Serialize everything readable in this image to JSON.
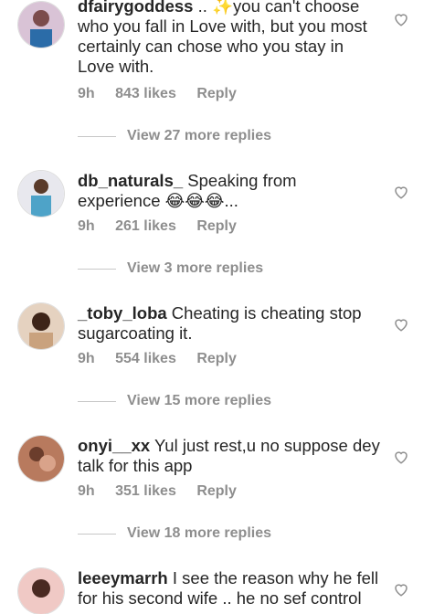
{
  "comments": [
    {
      "username": "dfairygoddess",
      "text": " .. ✨you can't choose who you fall in Love with, but you most certainly can chose who you stay in Love with.",
      "time": "9h",
      "likes": "843 likes",
      "reply_label": "Reply",
      "view_replies": "View 27 more replies"
    },
    {
      "username": "db_naturals_",
      "text": " Speaking from experience 😂😂😂...",
      "time": "9h",
      "likes": "261 likes",
      "reply_label": "Reply",
      "view_replies": "View 3 more replies"
    },
    {
      "username": "_toby_loba",
      "text": " Cheating is cheating stop sugarcoating it.",
      "time": "9h",
      "likes": "554 likes",
      "reply_label": "Reply",
      "view_replies": "View 15 more replies"
    },
    {
      "username": "onyi__xx",
      "text": " Yul just rest,u no suppose dey talk for this app",
      "time": "9h",
      "likes": "351 likes",
      "reply_label": "Reply",
      "view_replies": "View 18 more replies"
    },
    {
      "username": "leeeymarrh",
      "text": " I see the reason why he fell for his second wife .. he no sef control"
    }
  ],
  "colors": {
    "meta": "#8e8e8e",
    "text": "#262626"
  },
  "icons": {
    "like": "heart-icon"
  }
}
